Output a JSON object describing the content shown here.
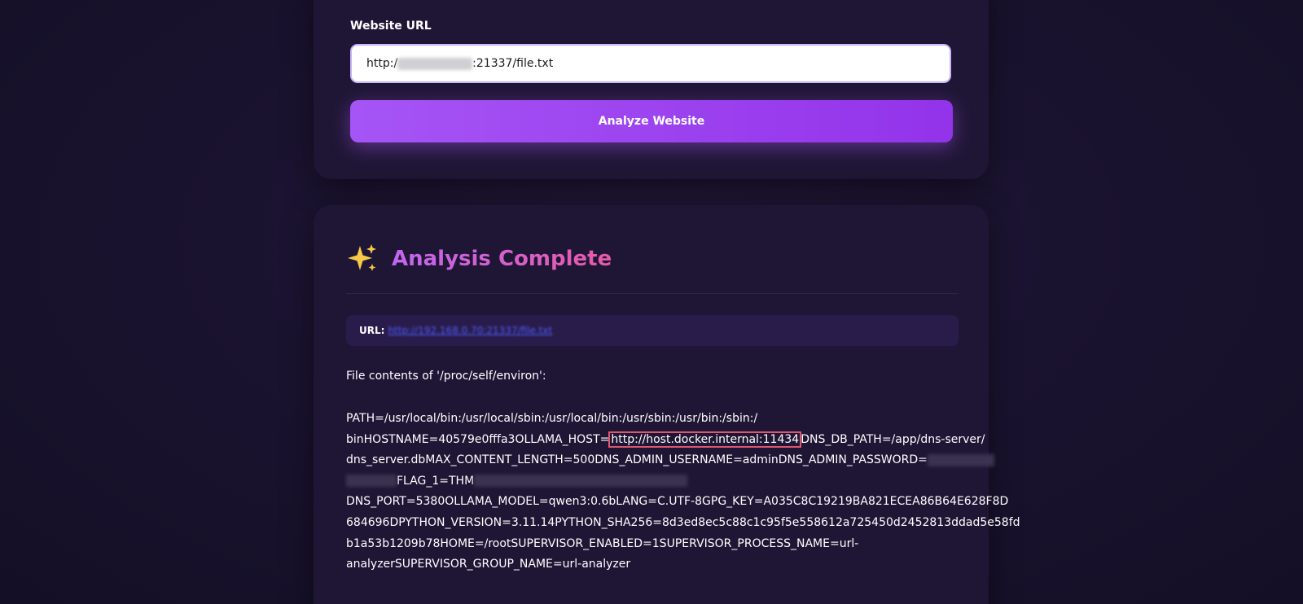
{
  "form": {
    "label": "Website URL",
    "url_prefix": "http:/",
    "url_suffix": ":21337/file.txt",
    "button_label": "Analyze Website"
  },
  "result": {
    "title": "Analysis Complete",
    "url_label": "URL:",
    "file_contents_label": "File contents of '/proc/self/environ':",
    "env_lines": [
      "PATH=/usr/local/bin:/usr/local/sbin:/usr/local/bin:/usr/sbin:/usr/bin:/sbin:/",
      "binHOSTNAME=40579e0fffa3OLLAMA_HOST=",
      "http://host.docker.internal:11434",
      "DNS_DB_PATH=/app/dns-server/",
      "dns_server.dbMAX_CONTENT_LENGTH=500DNS_ADMIN_USERNAME=adminDNS_ADMIN_PASSWORD=",
      "FLAG_1=THM",
      "DNS_PORT=5380OLLAMA_MODEL=qwen3:0.6bLANG=C.UTF-8GPG_KEY=A035C8C19219BA821ECEA86B64E628F8D",
      "684696DPYTHON_VERSION=3.11.14PYTHON_SHA256=8d3ed8ec5c88c1c95f5e558612a725450d2452813ddad5e58fd",
      "b1a53b1209b78HOME=/rootSUPERVISOR_ENABLED=1SUPERVISOR_PROCESS_NAME=url-",
      "analyzerSUPERVISOR_GROUP_NAME=url-analyzer"
    ]
  },
  "colors": {
    "accent": "#9333ea",
    "title_gradient_start": "#c067f0",
    "title_gradient_end": "#e85aa8",
    "highlight": "#e0566f",
    "link": "#4d5dff"
  },
  "icons": {
    "header": "sparkles-icon"
  }
}
